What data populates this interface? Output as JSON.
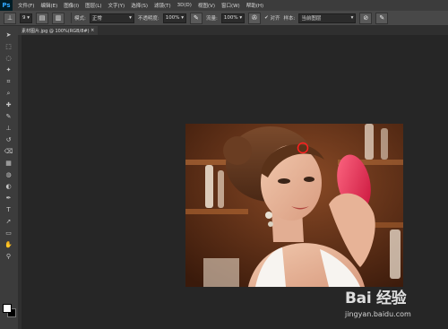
{
  "app": {
    "logo": "Ps"
  },
  "menu": [
    "文件(F)",
    "编辑(E)",
    "图像(I)",
    "图层(L)",
    "文字(Y)",
    "选择(S)",
    "滤镜(T)",
    "3D(D)",
    "视图(V)",
    "窗口(W)",
    "帮助(H)"
  ],
  "options": {
    "mode_label": "模式:",
    "mode_value": "正常",
    "opacity_label": "不透明度:",
    "opacity_value": "100%",
    "flow_label": "流量:",
    "flow_value": "100%",
    "align_label": "对齐",
    "sample_label": "样本:",
    "sample_value": "当前图层",
    "brush_size": "9"
  },
  "document": {
    "tab_label": "素材图片.jpg @ 100%(RGB/8#)",
    "close_glyph": "×"
  },
  "icons": [
    "move-icon",
    "marquee-icon",
    "lasso-icon",
    "quick-select-icon",
    "crop-icon",
    "eyedropper-icon",
    "healing-brush-icon",
    "brush-icon",
    "clone-stamp-icon",
    "history-brush-icon",
    "eraser-icon",
    "gradient-icon",
    "blur-icon",
    "dodge-icon",
    "pen-icon",
    "type-icon",
    "path-select-icon",
    "shape-icon",
    "hand-icon",
    "zoom-icon"
  ],
  "colors": {
    "foreground": "#ffffff",
    "background": "#000000",
    "brush_cursor": "#ff2020"
  },
  "watermark": {
    "brand": "Bai 经验",
    "site": "jingyan.baidu.com"
  }
}
